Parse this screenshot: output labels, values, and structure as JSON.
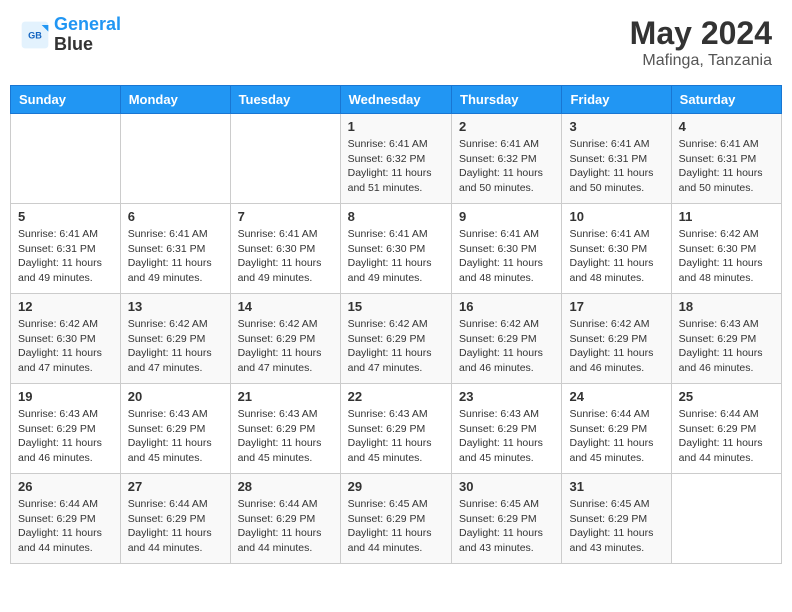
{
  "logo": {
    "line1": "General",
    "line2": "Blue"
  },
  "title": "May 2024",
  "location": "Mafinga, Tanzania",
  "weekdays": [
    "Sunday",
    "Monday",
    "Tuesday",
    "Wednesday",
    "Thursday",
    "Friday",
    "Saturday"
  ],
  "weeks": [
    [
      {
        "day": "",
        "info": ""
      },
      {
        "day": "",
        "info": ""
      },
      {
        "day": "",
        "info": ""
      },
      {
        "day": "1",
        "info": "Sunrise: 6:41 AM\nSunset: 6:32 PM\nDaylight: 11 hours\nand 51 minutes."
      },
      {
        "day": "2",
        "info": "Sunrise: 6:41 AM\nSunset: 6:32 PM\nDaylight: 11 hours\nand 50 minutes."
      },
      {
        "day": "3",
        "info": "Sunrise: 6:41 AM\nSunset: 6:31 PM\nDaylight: 11 hours\nand 50 minutes."
      },
      {
        "day": "4",
        "info": "Sunrise: 6:41 AM\nSunset: 6:31 PM\nDaylight: 11 hours\nand 50 minutes."
      }
    ],
    [
      {
        "day": "5",
        "info": "Sunrise: 6:41 AM\nSunset: 6:31 PM\nDaylight: 11 hours\nand 49 minutes."
      },
      {
        "day": "6",
        "info": "Sunrise: 6:41 AM\nSunset: 6:31 PM\nDaylight: 11 hours\nand 49 minutes."
      },
      {
        "day": "7",
        "info": "Sunrise: 6:41 AM\nSunset: 6:30 PM\nDaylight: 11 hours\nand 49 minutes."
      },
      {
        "day": "8",
        "info": "Sunrise: 6:41 AM\nSunset: 6:30 PM\nDaylight: 11 hours\nand 49 minutes."
      },
      {
        "day": "9",
        "info": "Sunrise: 6:41 AM\nSunset: 6:30 PM\nDaylight: 11 hours\nand 48 minutes."
      },
      {
        "day": "10",
        "info": "Sunrise: 6:41 AM\nSunset: 6:30 PM\nDaylight: 11 hours\nand 48 minutes."
      },
      {
        "day": "11",
        "info": "Sunrise: 6:42 AM\nSunset: 6:30 PM\nDaylight: 11 hours\nand 48 minutes."
      }
    ],
    [
      {
        "day": "12",
        "info": "Sunrise: 6:42 AM\nSunset: 6:30 PM\nDaylight: 11 hours\nand 47 minutes."
      },
      {
        "day": "13",
        "info": "Sunrise: 6:42 AM\nSunset: 6:29 PM\nDaylight: 11 hours\nand 47 minutes."
      },
      {
        "day": "14",
        "info": "Sunrise: 6:42 AM\nSunset: 6:29 PM\nDaylight: 11 hours\nand 47 minutes."
      },
      {
        "day": "15",
        "info": "Sunrise: 6:42 AM\nSunset: 6:29 PM\nDaylight: 11 hours\nand 47 minutes."
      },
      {
        "day": "16",
        "info": "Sunrise: 6:42 AM\nSunset: 6:29 PM\nDaylight: 11 hours\nand 46 minutes."
      },
      {
        "day": "17",
        "info": "Sunrise: 6:42 AM\nSunset: 6:29 PM\nDaylight: 11 hours\nand 46 minutes."
      },
      {
        "day": "18",
        "info": "Sunrise: 6:43 AM\nSunset: 6:29 PM\nDaylight: 11 hours\nand 46 minutes."
      }
    ],
    [
      {
        "day": "19",
        "info": "Sunrise: 6:43 AM\nSunset: 6:29 PM\nDaylight: 11 hours\nand 46 minutes."
      },
      {
        "day": "20",
        "info": "Sunrise: 6:43 AM\nSunset: 6:29 PM\nDaylight: 11 hours\nand 45 minutes."
      },
      {
        "day": "21",
        "info": "Sunrise: 6:43 AM\nSunset: 6:29 PM\nDaylight: 11 hours\nand 45 minutes."
      },
      {
        "day": "22",
        "info": "Sunrise: 6:43 AM\nSunset: 6:29 PM\nDaylight: 11 hours\nand 45 minutes."
      },
      {
        "day": "23",
        "info": "Sunrise: 6:43 AM\nSunset: 6:29 PM\nDaylight: 11 hours\nand 45 minutes."
      },
      {
        "day": "24",
        "info": "Sunrise: 6:44 AM\nSunset: 6:29 PM\nDaylight: 11 hours\nand 45 minutes."
      },
      {
        "day": "25",
        "info": "Sunrise: 6:44 AM\nSunset: 6:29 PM\nDaylight: 11 hours\nand 44 minutes."
      }
    ],
    [
      {
        "day": "26",
        "info": "Sunrise: 6:44 AM\nSunset: 6:29 PM\nDaylight: 11 hours\nand 44 minutes."
      },
      {
        "day": "27",
        "info": "Sunrise: 6:44 AM\nSunset: 6:29 PM\nDaylight: 11 hours\nand 44 minutes."
      },
      {
        "day": "28",
        "info": "Sunrise: 6:44 AM\nSunset: 6:29 PM\nDaylight: 11 hours\nand 44 minutes."
      },
      {
        "day": "29",
        "info": "Sunrise: 6:45 AM\nSunset: 6:29 PM\nDaylight: 11 hours\nand 44 minutes."
      },
      {
        "day": "30",
        "info": "Sunrise: 6:45 AM\nSunset: 6:29 PM\nDaylight: 11 hours\nand 43 minutes."
      },
      {
        "day": "31",
        "info": "Sunrise: 6:45 AM\nSunset: 6:29 PM\nDaylight: 11 hours\nand 43 minutes."
      },
      {
        "day": "",
        "info": ""
      }
    ]
  ]
}
